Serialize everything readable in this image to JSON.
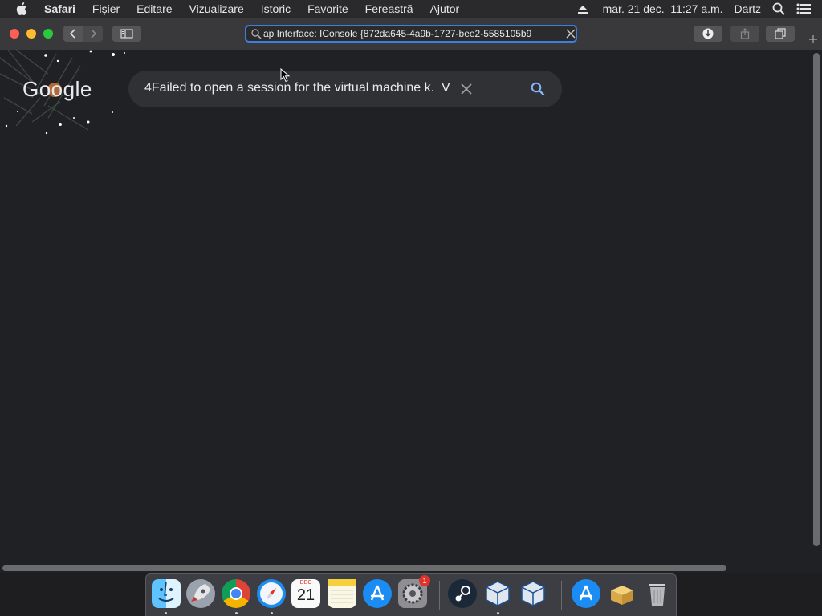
{
  "menubar": {
    "app_name": "Safari",
    "items": [
      "Fișier",
      "Editare",
      "Vizualizare",
      "Istoric",
      "Favorite",
      "Fereastră",
      "Ajutor"
    ],
    "datetime": "mar. 21 dec.  11:27 a.m.",
    "user": "Dartz"
  },
  "toolbar": {
    "url_text": "ap Interface: IConsole {872da645-4a9b-1727-bee2-5585105b9"
  },
  "page": {
    "logo_text": "Google",
    "search_value": "4Failed to open a session for the virtual machine k.  V"
  },
  "dock": {
    "calendar_month": "DEC",
    "calendar_day": "21",
    "settings_badge": "1",
    "apps": [
      "finder",
      "launchpad",
      "chrome",
      "safari",
      "calendar",
      "notes",
      "app-store",
      "system-preferences",
      "steam",
      "virtualbox",
      "virtualbox-manager",
      "app-store-utility",
      "installer",
      "trash"
    ]
  }
}
